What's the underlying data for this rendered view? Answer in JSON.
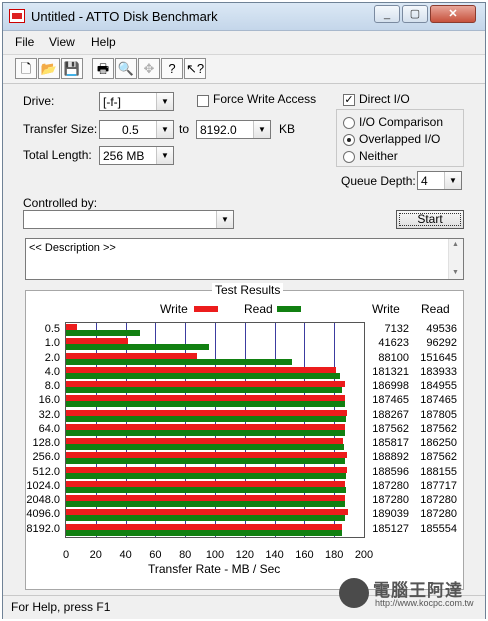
{
  "window": {
    "title": "Untitled - ATTO Disk Benchmark"
  },
  "menu": [
    "File",
    "View",
    "Help"
  ],
  "toolbar_icons": [
    "new-icon",
    "open-icon",
    "save-icon",
    "print-icon",
    "print-preview-icon",
    "move-icon",
    "help-icon",
    "context-help-icon"
  ],
  "form": {
    "drive_label": "Drive:",
    "drive_value": "[-f-]",
    "force_write_label": "Force Write Access",
    "force_write_checked": false,
    "direct_io_label": "Direct I/O",
    "direct_io_checked": true,
    "transfer_size_label": "Transfer Size:",
    "transfer_from": "0.5",
    "to_label": "to",
    "transfer_to": "8192.0",
    "kb_label": "KB",
    "total_length_label": "Total Length:",
    "total_length": "256 MB",
    "io_options": [
      {
        "label": "I/O Comparison",
        "selected": false
      },
      {
        "label": "Overlapped I/O",
        "selected": true
      },
      {
        "label": "Neither",
        "selected": false
      }
    ],
    "queue_depth_label": "Queue Depth:",
    "queue_depth": "4",
    "controlled_by_label": "Controlled by:",
    "controlled_by_value": "",
    "start_label": "Start",
    "description": "<< Description >>"
  },
  "results": {
    "title": "Test Results",
    "write_legend": "Write",
    "read_legend": "Read",
    "write_header": "Write",
    "read_header": "Read",
    "xlabel": "Transfer Rate - MB / Sec",
    "colors": {
      "write": "#ec1c1c",
      "read": "#118011"
    }
  },
  "chart_data": {
    "type": "bar",
    "orientation": "horizontal",
    "title": "Test Results",
    "xlabel": "Transfer Rate - MB / Sec",
    "xlim": [
      0,
      200
    ],
    "xticks": [
      "0",
      "20",
      "40",
      "60",
      "80",
      "100",
      "120",
      "140",
      "160",
      "180",
      "200"
    ],
    "categories": [
      "0.5",
      "1.0",
      "2.0",
      "4.0",
      "8.0",
      "16.0",
      "32.0",
      "64.0",
      "128.0",
      "256.0",
      "512.0",
      "1024.0",
      "2048.0",
      "4096.0",
      "8192.0"
    ],
    "series": [
      {
        "name": "Write",
        "values": [
          7132,
          41623,
          88100,
          181321,
          186998,
          187465,
          188267,
          187562,
          185817,
          188892,
          188596,
          187280,
          187280,
          189039,
          185127
        ]
      },
      {
        "name": "Read",
        "values": [
          49536,
          96292,
          151645,
          183933,
          184955,
          187465,
          187805,
          187562,
          186250,
          187562,
          188155,
          187717,
          187280,
          187280,
          185554
        ]
      }
    ]
  },
  "status": {
    "text": "For Help, press F1"
  },
  "watermark": {
    "text": "電腦王阿達",
    "url": "http://www.kocpc.com.tw"
  }
}
